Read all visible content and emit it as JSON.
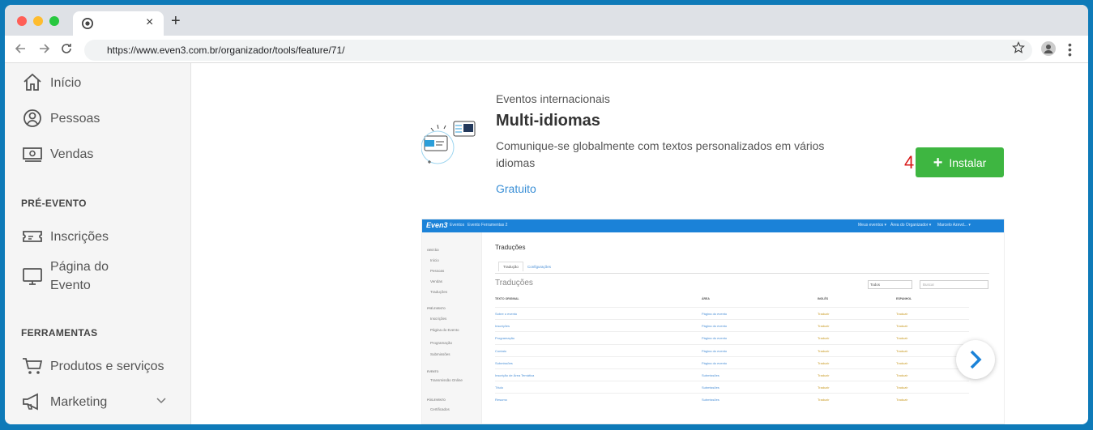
{
  "browser": {
    "tab_close": "×",
    "new_tab": "+",
    "url": "https://www.even3.com.br/organizador/tools/feature/71/"
  },
  "sidebar": {
    "items_top": [
      {
        "label": "Início",
        "icon": "home-icon"
      },
      {
        "label": "Pessoas",
        "icon": "person-icon"
      },
      {
        "label": "Vendas",
        "icon": "money-icon"
      }
    ],
    "section_pre": "PRÉ-EVENTO",
    "items_pre": [
      {
        "label": "Inscrições",
        "icon": "ticket-icon"
      },
      {
        "label_line1": "Página do",
        "label_line2": "Evento",
        "icon": "monitor-icon"
      }
    ],
    "section_tools": "FERRAMENTAS",
    "items_tools": [
      {
        "label": "Produtos e serviços",
        "icon": "cart-icon"
      },
      {
        "label": "Marketing",
        "icon": "megaphone-icon"
      }
    ]
  },
  "feature": {
    "category": "Eventos internacionais",
    "title": "Multi-idiomas",
    "description": "Comunique-se globalmente com textos personalizados em vários idiomas",
    "price": "Gratuito",
    "step_marker": "4",
    "install_plus": "+",
    "install_label": "Instalar",
    "accent_color": "#3eb641"
  },
  "preview": {
    "logo": "Even3",
    "top_items": [
      "Eventos",
      "Evento Ferramentas 2",
      "Meus eventos ▾",
      "Área do Organizador ▾",
      "Marcelo Azevd... ▾"
    ],
    "side": {
      "section1": "GESTÃO",
      "items1": [
        "Início",
        "Pessoas",
        "Vendas",
        "Traduções"
      ],
      "section2": "PRÉ-EVENTO",
      "items2": [
        "Inscrições",
        "Página do Evento",
        "Programação",
        "Submissões"
      ],
      "section3": "EVENTO",
      "items3": [
        "Transmissão Online"
      ],
      "section4": "PÓS-EVENTO",
      "items4": [
        "Certificados"
      ]
    },
    "page_title": "Traduções",
    "tabs": [
      "Tradução",
      "Configurações"
    ],
    "subtitle": "Traduções",
    "filter_value": "Todos",
    "search_placeholder": "Buscar",
    "columns": [
      "TEXTO ORIGINAL",
      "ÁREA",
      "INGLÊS",
      "ESPANHOL"
    ],
    "rows": [
      [
        "Sobre o evento",
        "Página do evento",
        "Traduzir",
        "Traduzir"
      ],
      [
        "Inscrições",
        "Página do evento",
        "Traduzir",
        "Traduzir"
      ],
      [
        "Programação",
        "Página do evento",
        "Traduzir",
        "Traduzir"
      ],
      [
        "Contato",
        "Página do evento",
        "Traduzir",
        "Traduzir"
      ],
      [
        "Submissões",
        "Página do evento",
        "Traduzir",
        "Traduzir"
      ],
      [
        "Inscrição de Área Temática",
        "Submissões",
        "Traduzir",
        "Traduzir"
      ],
      [
        "Título",
        "Submissões",
        "Traduzir",
        "Traduzir"
      ],
      [
        "Resumo",
        "Submissões",
        "Traduzir",
        "Traduzir"
      ]
    ]
  }
}
